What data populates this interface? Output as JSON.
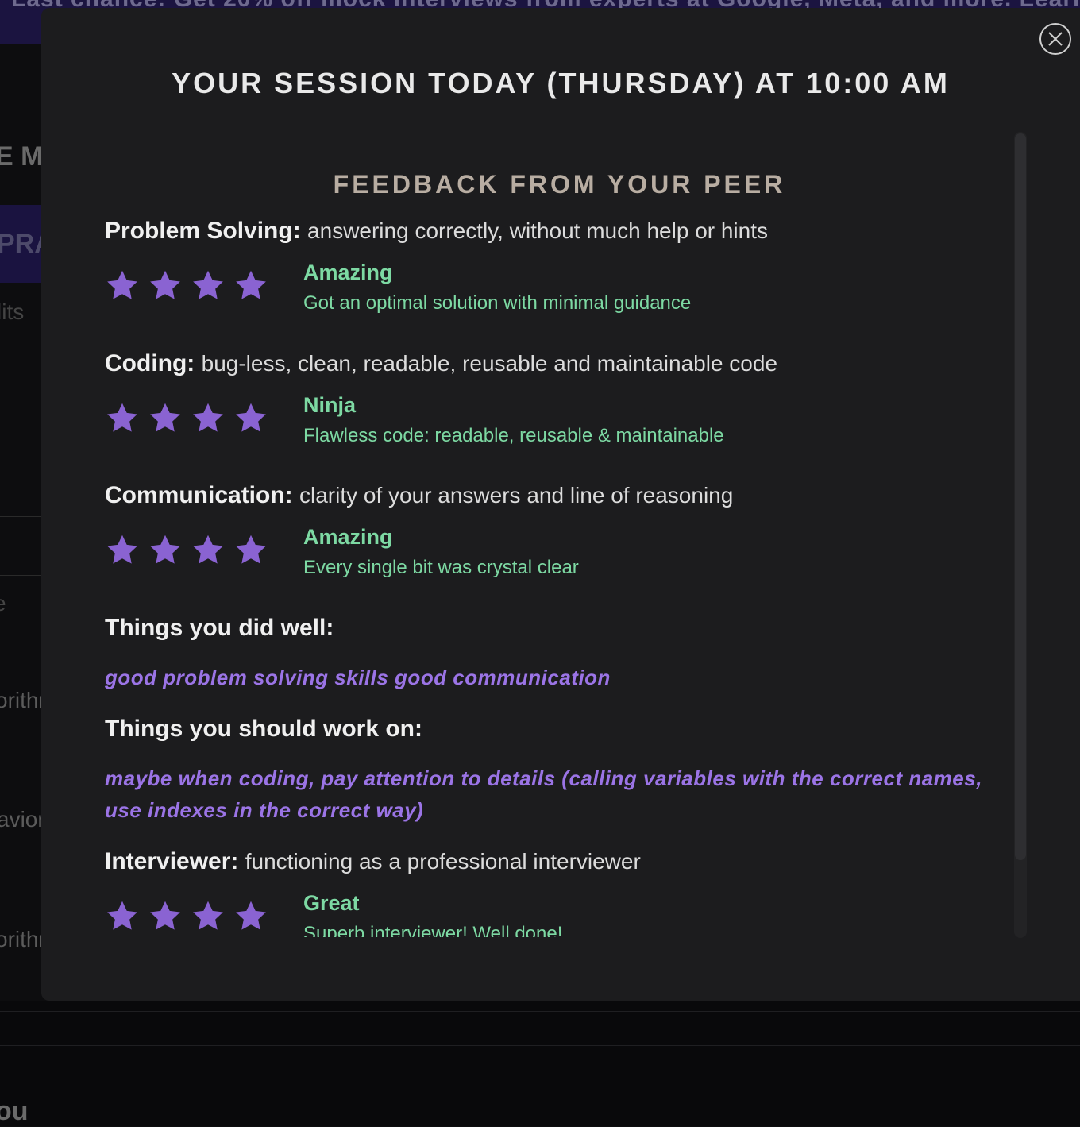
{
  "background": {
    "banner_text": "Last chance: Get 20% off mock interviews from experts at Google, Meta, and more. Learn more",
    "fragments": [
      "E M",
      "PRA",
      "lits",
      "e",
      "orithm",
      "avior",
      "orithm",
      "ou"
    ]
  },
  "modal": {
    "title": "YOUR SESSION TODAY (THURSDAY) AT 10:00 AM",
    "section_heading": "FEEDBACK FROM YOUR PEER",
    "criteria": [
      {
        "name": "Problem Solving:",
        "description": "answering correctly, without much help or hints",
        "stars": 4,
        "rating": "Amazing",
        "rating_description": "Got an optimal solution with minimal guidance"
      },
      {
        "name": "Coding:",
        "description": "bug-less, clean, readable, reusable and maintainable code",
        "stars": 4,
        "rating": "Ninja",
        "rating_description": "Flawless code: readable, reusable & maintainable"
      },
      {
        "name": "Communication:",
        "description": "clarity of your answers and line of reasoning",
        "stars": 4,
        "rating": "Amazing",
        "rating_description": "Every single bit was crystal clear"
      }
    ],
    "did_well": {
      "heading": "Things you did well:",
      "text": "good problem solving skills good communication"
    },
    "work_on": {
      "heading": "Things you should work on:",
      "text": "maybe when coding, pay attention to details (calling variables with the correct names, use indexes in the correct way)"
    },
    "interviewer": {
      "name": "Interviewer:",
      "description": "functioning as a professional interviewer",
      "stars": 4,
      "rating": "Great",
      "rating_description": "Superb interviewer! Well done!"
    }
  },
  "colors": {
    "star": "#8a63d2",
    "rating": "#7dd9a3",
    "list_text": "#9b74e6",
    "modal_bg": "#1c1c1e"
  },
  "icons": {
    "close": "close-icon",
    "star": "star-icon"
  }
}
